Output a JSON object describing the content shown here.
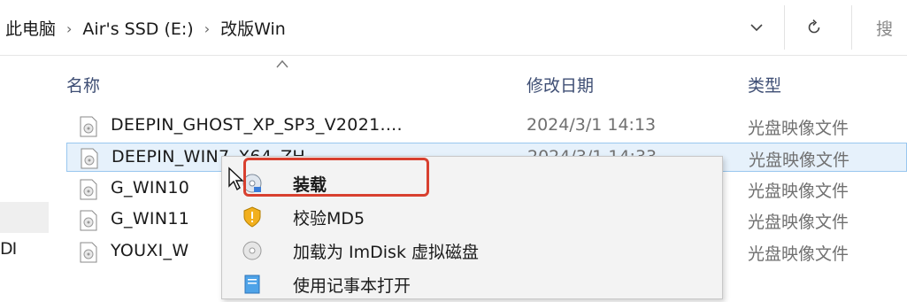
{
  "address": {
    "crumbs": [
      "此电脑",
      "Air's SSD (E:)",
      "改版Win"
    ],
    "separator": "›",
    "search_cut": "搜"
  },
  "columns": {
    "name": "名称",
    "date": "修改日期",
    "type": "类型"
  },
  "leftnav": {
    "visible_label": "DI"
  },
  "files": [
    {
      "name": "DEEPIN_GHOST_XP_SP3_V2021....",
      "date": "2024/3/1 14:13",
      "type": "光盘映像文件"
    },
    {
      "name": "DEEPIN_WIN7_X64_ZH...",
      "date": "2024/3/1 14:33",
      "type": "光盘映像文件"
    },
    {
      "name": "G_WIN10",
      "date": "",
      "type": "光盘映像文件"
    },
    {
      "name": "G_WIN11",
      "date": "",
      "type": "光盘映像文件"
    },
    {
      "name": "YOUXI_W",
      "date": "",
      "type": "光盘映像文件"
    }
  ],
  "context_menu": {
    "items": [
      {
        "label": "装载",
        "icon": "disc-mount-icon",
        "bold": true
      },
      {
        "label": "校验MD5",
        "icon": "shield-warning-icon",
        "bold": false
      },
      {
        "label": "加载为 ImDisk 虚拟磁盘",
        "icon": "disc-icon",
        "bold": false
      },
      {
        "label": "使用记事本打开",
        "icon": "notepad-icon",
        "bold": false
      }
    ]
  },
  "colors": {
    "selected_row": "#e6f1fb",
    "highlight_border": "#d8402f",
    "header_text": "#3e4e74"
  }
}
